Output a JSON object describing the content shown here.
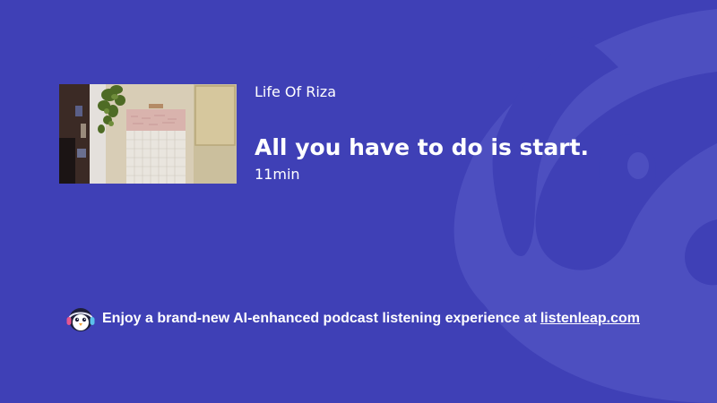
{
  "episode": {
    "show_name": "Life Of Riza",
    "title": "All you have to do is start.",
    "duration": "11min"
  },
  "promo": {
    "text": "Enjoy a brand-new AI-enhanced podcast listening experience at",
    "link_text": "listenleap.com"
  },
  "icons": {
    "background": "listenleap-mascot-icon",
    "promo_logo": "penguin-headphones-icon"
  },
  "colors": {
    "background": "#3f40b6",
    "text": "#ffffff"
  }
}
